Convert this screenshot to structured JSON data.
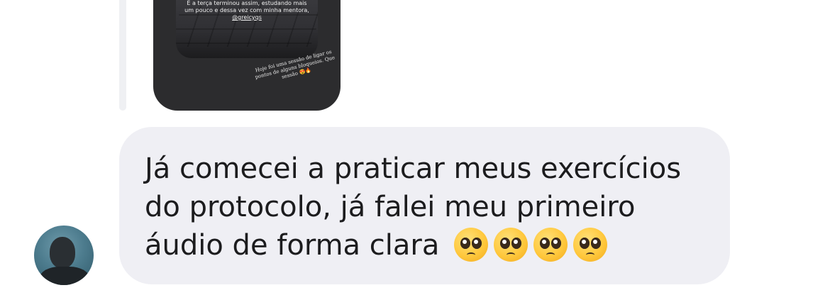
{
  "story_reply": {
    "caption": "É a terça terminou assim, estudando mais um pouco e dessa vez com minha mentora,",
    "mention": "@greicyqs",
    "note": "Hoje foi uma sessão de ligar os pontos de alguns bloqueios. Que sessão 😍🔥"
  },
  "message": {
    "text": "Já comecei a praticar meus exercícios do protocolo, já falei meu primeiro áudio de forma clara",
    "emojis": [
      "🥹",
      "🥹",
      "🥹",
      "🥹"
    ]
  },
  "sender": {
    "avatar_icon": "person-avatar"
  },
  "colors": {
    "bubble": "#efeff4",
    "text": "#1c1c1e",
    "story_bg": "#2c2c2e",
    "reply_bar": "#eff0f3"
  }
}
